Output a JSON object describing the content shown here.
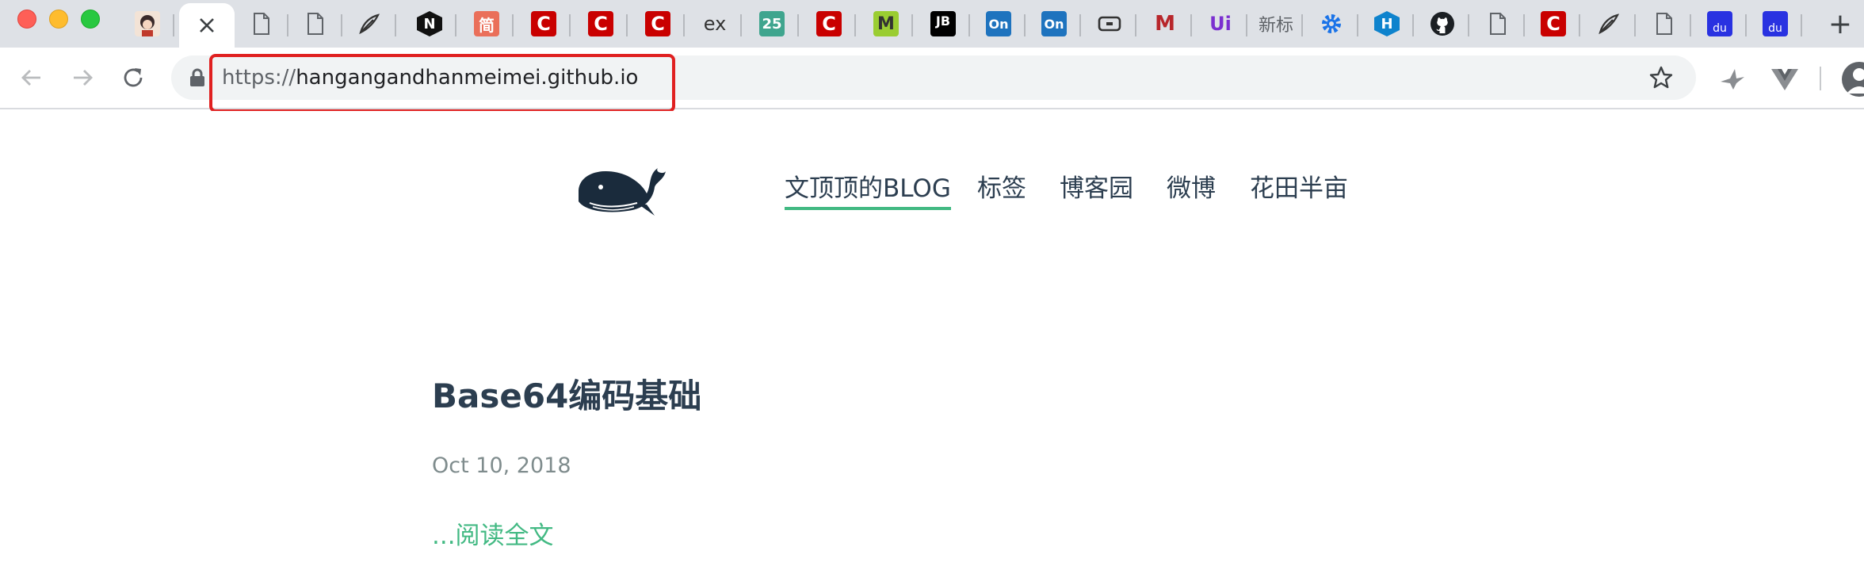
{
  "browser": {
    "tabs": [
      {
        "icon": "avatar-icon",
        "active": false
      },
      {
        "icon": "close-icon",
        "active": true
      },
      {
        "icon": "document-icon"
      },
      {
        "icon": "document-icon"
      },
      {
        "icon": "feather-icon"
      },
      {
        "icon": "n-logo-icon",
        "text": "N"
      },
      {
        "icon": "jianshu-icon",
        "text": "简"
      },
      {
        "icon": "csdn-icon",
        "text": "C"
      },
      {
        "icon": "csdn-icon",
        "text": "C"
      },
      {
        "icon": "csdn-icon",
        "text": "C"
      },
      {
        "icon": "ex-icon",
        "text": "ex"
      },
      {
        "icon": "calendar-25-icon",
        "text": "25"
      },
      {
        "icon": "csdn-icon",
        "text": "C"
      },
      {
        "icon": "m-logo-icon",
        "text": "M"
      },
      {
        "icon": "jetbrains-icon",
        "text": "JB"
      },
      {
        "icon": "on-logo-icon",
        "text": "On"
      },
      {
        "icon": "on-logo-icon",
        "text": "On"
      },
      {
        "icon": "bracket-icon"
      },
      {
        "icon": "mooc-icon",
        "text": "M"
      },
      {
        "icon": "ui-logo-icon",
        "text": "Ui"
      },
      {
        "icon": "text-tab-icon",
        "text": "新标"
      },
      {
        "icon": "gear-icon"
      },
      {
        "icon": "hexo-icon",
        "text": "H"
      },
      {
        "icon": "github-icon"
      },
      {
        "icon": "document-icon"
      },
      {
        "icon": "csdn-icon",
        "text": "C"
      },
      {
        "icon": "feather-icon"
      },
      {
        "icon": "document-icon"
      },
      {
        "icon": "baidu-icon",
        "text": "du"
      },
      {
        "icon": "baidu-icon",
        "text": "du"
      }
    ],
    "new_tab_label": "+",
    "url_scheme": "https://",
    "url_host": "hangangandhanmeimei.github.io",
    "colors": {
      "tabstrip": "#dee1e6",
      "highlight": "#e02020",
      "csdn": "#c90000",
      "accent": "#42b983"
    }
  },
  "site": {
    "nav": [
      "文顶顶的BLOG",
      "标签",
      "博客园",
      "微博",
      "花田半亩"
    ],
    "active_nav": "文顶顶的BLOG"
  },
  "post": {
    "title": "Base64编码基础",
    "date": "Oct 10, 2018",
    "read_more": "...阅读全文"
  }
}
